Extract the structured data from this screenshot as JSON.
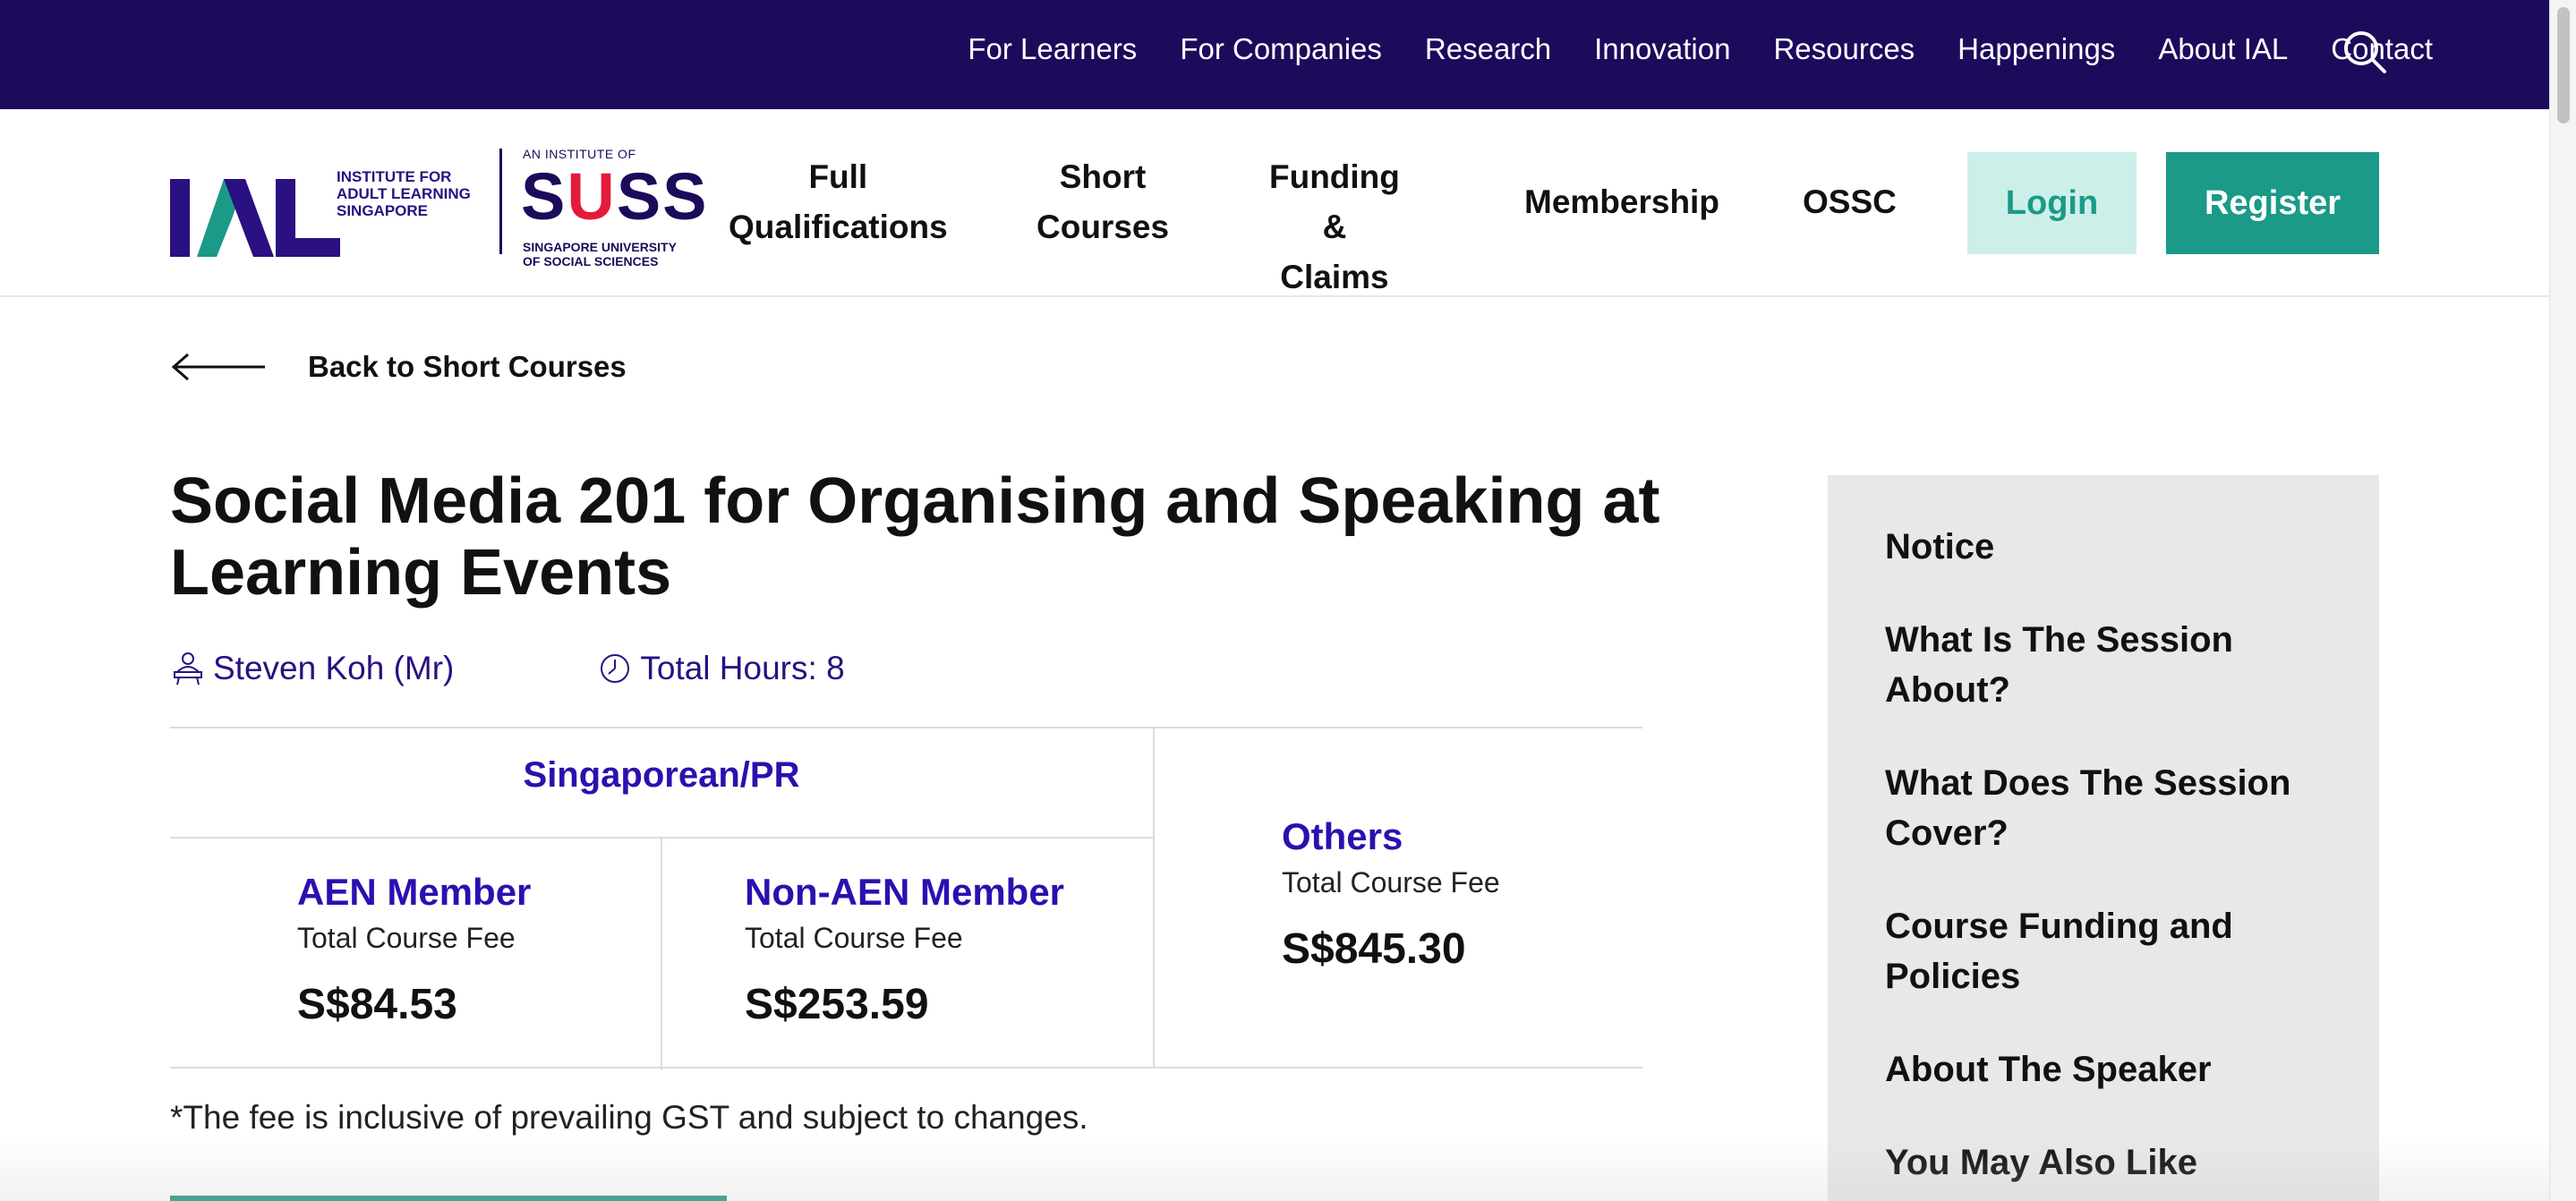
{
  "topbar": {
    "links": [
      "For Learners",
      "For Companies",
      "Research",
      "Innovation",
      "Resources",
      "Happenings",
      "About IAL",
      "Contact"
    ],
    "search_icon": "search-icon"
  },
  "logo": {
    "ial_text": "IAL",
    "ial_sub_1": "INSTITUTE FOR",
    "ial_sub_2": "ADULT LEARNING",
    "ial_sub_3": "SINGAPORE",
    "suss_top": "AN INSTITUTE OF",
    "suss_1": "S",
    "suss_2": "U",
    "suss_3": "SS",
    "suss_bottom_1": "SINGAPORE UNIVERSITY",
    "suss_bottom_2": "OF SOCIAL SCIENCES"
  },
  "nav": {
    "full_qualifications": "Full\nQualifications",
    "short_courses": "Short\nCourses",
    "funding_claims": "Funding &\nClaims",
    "membership": "Membership",
    "ossc": "OSSC",
    "login": "Login",
    "register": "Register"
  },
  "back": {
    "label": "Back to Short Courses"
  },
  "course": {
    "title": "Social Media 201 for Organising and Speaking at Learning Events",
    "speaker": "Steven Koh (Mr)",
    "total_hours": "Total Hours: 8"
  },
  "fees": {
    "group_label": "Singaporean/PR",
    "aen": {
      "heading": "AEN Member",
      "sub": "Total Course Fee",
      "value": "S$84.53"
    },
    "non_aen": {
      "heading": "Non-AEN Member",
      "sub": "Total Course Fee",
      "value": "S$253.59"
    },
    "others": {
      "heading": "Others",
      "sub": "Total Course Fee",
      "value": "S$845.30"
    },
    "note": "*The fee is inclusive of prevailing GST and subject to changes."
  },
  "sidebar": {
    "items": [
      "Notice",
      "What Is The Session About?",
      "What Does The Session Cover?",
      "Course Funding and Policies",
      "About The Speaker",
      "You May Also Like"
    ]
  },
  "colors": {
    "topbar": "#1c0a5b",
    "accent_purple": "#2d0fb0",
    "teal": "#1a9a87",
    "teal_light": "#cdefea",
    "sidebar_bg": "#e8e8e8",
    "suss_red": "#e31b3a"
  }
}
